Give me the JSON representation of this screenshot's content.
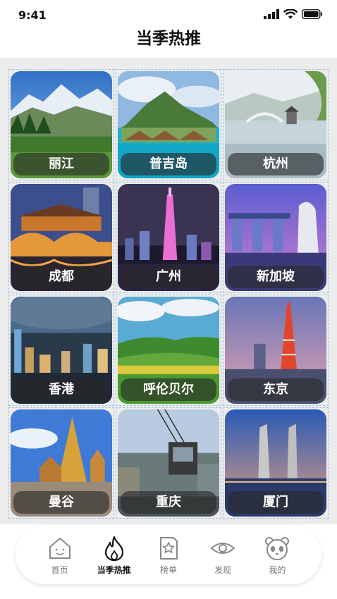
{
  "status_bar": {
    "time": "9:41"
  },
  "header": {
    "title": "当季热推"
  },
  "destinations": [
    {
      "name": "丽江",
      "scene": "mountain-lake"
    },
    {
      "name": "普吉岛",
      "scene": "tropical-island"
    },
    {
      "name": "杭州",
      "scene": "lake-bridge"
    },
    {
      "name": "成都",
      "scene": "night-bridge"
    },
    {
      "name": "广州",
      "scene": "tv-tower-night"
    },
    {
      "name": "新加坡",
      "scene": "marina-merlion"
    },
    {
      "name": "香港",
      "scene": "harbour-night"
    },
    {
      "name": "呼伦贝尔",
      "scene": "grassland"
    },
    {
      "name": "东京",
      "scene": "tokyo-tower"
    },
    {
      "name": "曼谷",
      "scene": "temple"
    },
    {
      "name": "重庆",
      "scene": "cable-car"
    },
    {
      "name": "厦门",
      "scene": "twin-towers"
    }
  ],
  "tabbar": {
    "items": [
      {
        "label": "首页",
        "icon": "home-icon"
      },
      {
        "label": "当季热推",
        "icon": "flame-icon"
      },
      {
        "label": "榜单",
        "icon": "ranking-icon"
      },
      {
        "label": "发现",
        "icon": "eye-icon"
      },
      {
        "label": "我的",
        "icon": "panda-icon"
      }
    ],
    "active_index": 1
  }
}
